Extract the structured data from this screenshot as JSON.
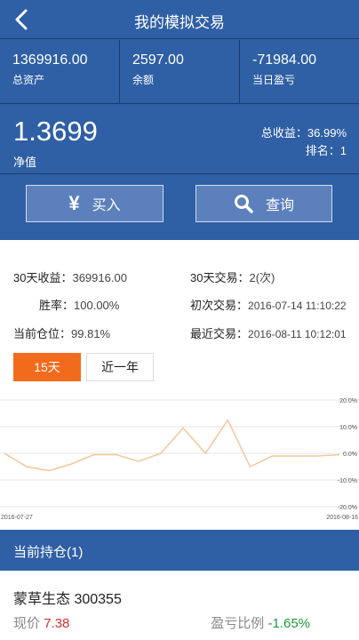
{
  "header": {
    "title": "我的模拟交易",
    "stats": [
      {
        "value": "1369916.00",
        "label": "总资产"
      },
      {
        "value": "2597.00",
        "label": "余额"
      },
      {
        "value": "-71984.00",
        "label": "当日盈亏"
      }
    ],
    "net_value": "1.3699",
    "net_label": "净值",
    "total_return": "总收益：36.99%",
    "rank": "排名：1",
    "buy_icon": "¥",
    "buy_label": "买入",
    "query_label": "查询"
  },
  "info": {
    "return30_k": "30天收益：",
    "return30_v": "369916.00",
    "trades30_k": "30天交易：",
    "trades30_v": "2(次)",
    "winrate_k": "胜率：",
    "winrate_v": "100.00%",
    "first_k": "初次交易：",
    "first_v": "2016-07-14 11:10:22",
    "position_k": "当前仓位：",
    "position_v": "99.81%",
    "recent_k": "最近交易：",
    "recent_v": "2016-08-11 10:12:01"
  },
  "tabs": {
    "active": "15天",
    "inactive": "近一年"
  },
  "chart_data": {
    "type": "line",
    "x_start": "2016-07-27",
    "x_end": "2016-08-16",
    "y_tick_labels": [
      "20.0%",
      "10.0%",
      "0.0%",
      "-10.0%",
      "-20.0%"
    ],
    "y_ticks": [
      20,
      10,
      0,
      -10,
      -20
    ],
    "ylim": [
      -20,
      20
    ],
    "values": [
      0,
      -5,
      -6.5,
      -4,
      -0.5,
      -0.5,
      -3,
      0,
      9.5,
      0,
      12.5,
      -5,
      -1,
      -1,
      -1,
      -0.5
    ],
    "grid": true,
    "series_color": "#f2c79a"
  },
  "holdings": {
    "title": "当前持仓(1)",
    "stock": "蒙草生态 300355",
    "price_label": "现价",
    "price": "7.38",
    "pl_label": "盈亏比例",
    "pl": "-1.65%"
  }
}
